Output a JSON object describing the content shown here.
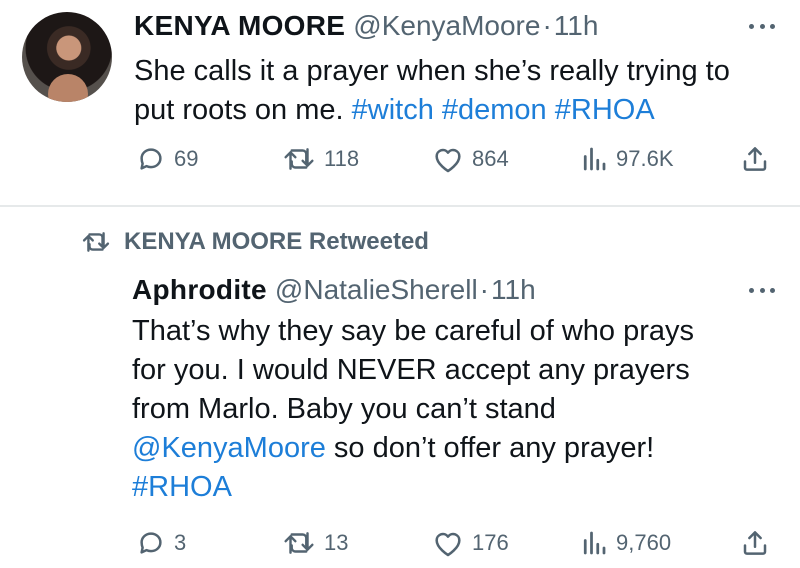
{
  "tweet1": {
    "name": "KENYA MOORE",
    "handle": "@KenyaMoore",
    "separator": "·",
    "time": "11h",
    "text_line1": "She calls it a prayer when she’s really trying to",
    "text_line2_plain": "put roots on me.",
    "tags": [
      "#witch",
      "#demon",
      "#RHOA"
    ],
    "replies": "69",
    "retweets": "118",
    "likes": "864",
    "views": "97.6K"
  },
  "retweet_notice": "KENYA MOORE Retweeted",
  "tweet2": {
    "name": "Aphrodite",
    "handle": "@NatalieSherell",
    "separator": "·",
    "time": "11h",
    "text_line1": "That’s why they say be careful of who prays",
    "text_line2": "for you. I would NEVER accept any prayers",
    "text_line3": "from Marlo. Baby you can’t stand",
    "mention": "@KenyaMoore",
    "text_line4_rest": " so don’t offer any prayer!",
    "tag": "#RHOA",
    "replies": "3",
    "retweets": "13",
    "likes": "176",
    "views": "9,760"
  },
  "icons": {
    "reply": "reply-icon",
    "retweet": "retweet-icon",
    "like": "heart-icon",
    "views": "views-icon",
    "share": "share-icon",
    "more": "more-icon",
    "avatar": "avatar"
  },
  "colors": {
    "text": "#0f1419",
    "secondary": "#536471",
    "link": "#1d7ed8",
    "divider": "#e6e9ea"
  }
}
